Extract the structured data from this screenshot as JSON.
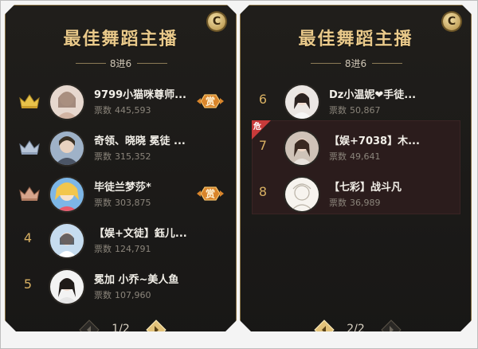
{
  "colors": {
    "gold": "#d8b063",
    "title_gold": "#e9c98a",
    "panel_bg": "#1c1a18",
    "danger_red": "#c83a3a"
  },
  "panels": [
    {
      "badge": "C",
      "title": "最佳舞蹈主播",
      "subtitle": "8进6",
      "entries": [
        {
          "rank": "1",
          "crown": "gold-crown-icon",
          "name": "9799小猫咪尊师...",
          "votes_label": "票数",
          "votes": "445,593",
          "reward": "赏"
        },
        {
          "rank": "2",
          "crown": "silver-crown-icon",
          "name": "奇领、晓晓 冕徒 ...",
          "votes_label": "票数",
          "votes": "315,352",
          "reward": ""
        },
        {
          "rank": "3",
          "crown": "bronze-crown-icon",
          "name": "毕徒兰梦莎*",
          "votes_label": "票数",
          "votes": "303,875",
          "reward": "赏"
        },
        {
          "rank": "4",
          "crown": "",
          "name": "【娱+文徒】鈺儿...",
          "votes_label": "票数",
          "votes": "124,791",
          "reward": ""
        },
        {
          "rank": "5",
          "crown": "",
          "name": "冕加 小乔~美人鱼",
          "votes_label": "票数",
          "votes": "107,960",
          "reward": ""
        }
      ],
      "pager": {
        "text": "1/2"
      }
    },
    {
      "badge": "C",
      "title": "最佳舞蹈主播",
      "subtitle": "8进6",
      "danger_label": "危",
      "entries": [
        {
          "rank": "6",
          "name": "Dz小温妮❤手徒...",
          "votes_label": "票数",
          "votes": "50,867"
        },
        {
          "rank": "7",
          "name": "【娱+7038】木...",
          "votes_label": "票数",
          "votes": "49,641"
        },
        {
          "rank": "8",
          "name": "【七彩】战斗凡",
          "votes_label": "票数",
          "votes": "36,989"
        }
      ],
      "pager": {
        "text": "2/2"
      }
    }
  ]
}
